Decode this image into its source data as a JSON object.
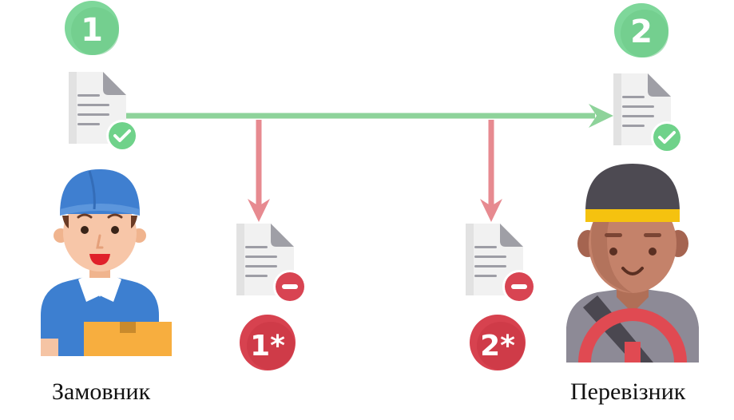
{
  "badges": {
    "step_1": "1",
    "step_2": "2",
    "alt_1": "1*",
    "alt_2": "2*"
  },
  "labels": {
    "customer": "Замовник",
    "carrier": "Перевізник"
  },
  "icons": {
    "doc_ok": "document-check-icon",
    "doc_reject": "document-minus-icon",
    "customer": "courier-with-box-icon",
    "carrier": "driver-with-wheel-icon"
  },
  "colors": {
    "green_badge": "#7ed79a",
    "green_arrow": "#8ed39a",
    "red_arrow": "#e78a90",
    "red_badge": "#d7424f",
    "check": "#6fd28a",
    "minus": "#d84452"
  }
}
